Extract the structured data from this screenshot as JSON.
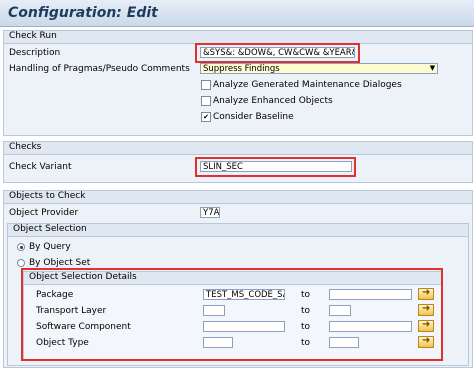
{
  "window_title": "Configuration: Edit",
  "check_run": {
    "header": "Check Run",
    "description_label": "Description",
    "description_value": "&SYS&: &DOW&, CW&CW& &YEAR&",
    "pragmas_label": "Handling of Pragmas/Pseudo Comments",
    "pragmas_value": "Suppress Findings",
    "options": [
      {
        "label": "Analyze Generated Maintenance Dialoges",
        "checked": false
      },
      {
        "label": "Analyze Enhanced Objects",
        "checked": false
      },
      {
        "label": "Consider Baseline",
        "checked": true
      }
    ]
  },
  "checks": {
    "header": "Checks",
    "variant_label": "Check Variant",
    "variant_value": "SLIN_SEC"
  },
  "objects": {
    "header": "Objects to Check",
    "provider_label": "Object Provider",
    "provider_value": "Y7A",
    "selection_header": "Object Selection",
    "by_query": "By Query",
    "by_object_set": "By Object Set",
    "details_header": "Object Selection Details",
    "to_label": "to",
    "rows": [
      {
        "label": "Package",
        "from": "TEST_MS_CODE_SA...",
        "to": ""
      },
      {
        "label": "Transport Layer",
        "from": "",
        "to": ""
      },
      {
        "label": "Software Component",
        "from": "",
        "to": ""
      },
      {
        "label": "Object Type",
        "from": "",
        "to": ""
      }
    ]
  },
  "icons": {
    "multi_select": "arrow-right-icon",
    "dropdown": "chevron-down-icon",
    "check": "checkmark-icon"
  },
  "colors": {
    "highlight": "#e03030",
    "title": "#1f3b5c"
  }
}
